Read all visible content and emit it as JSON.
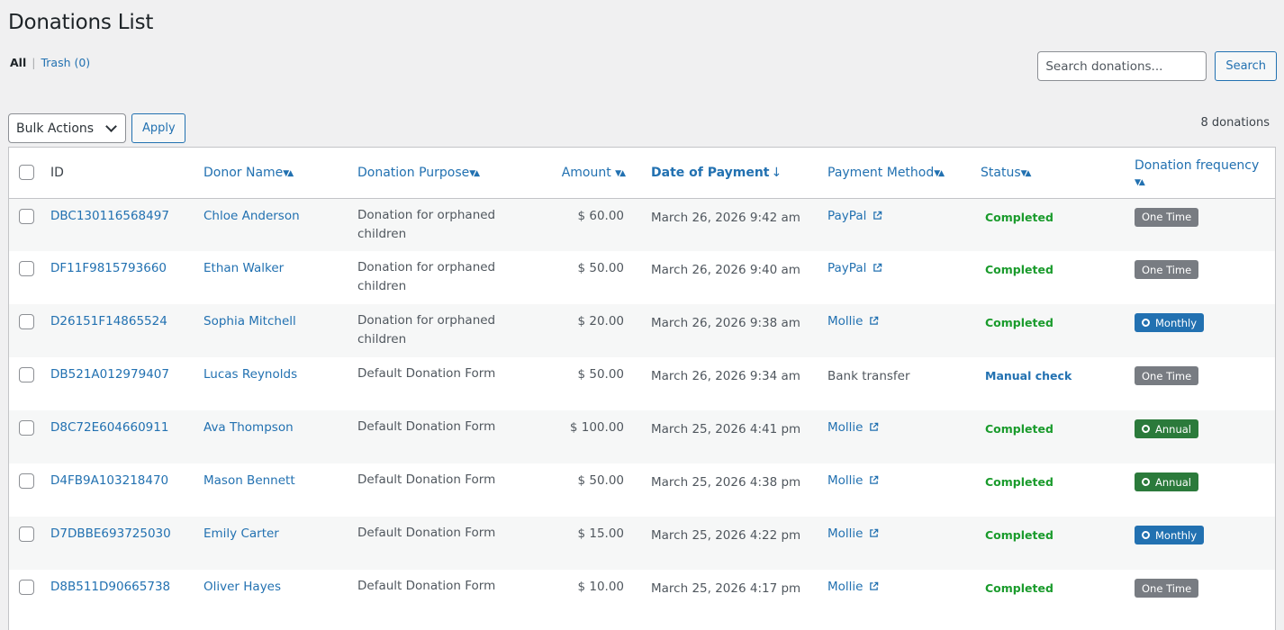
{
  "title": "Donations List",
  "filters": {
    "all": "All",
    "trash": "Trash (0)"
  },
  "search": {
    "placeholder": "Search donations...",
    "button": "Search"
  },
  "bulk": {
    "label": "Bulk Actions",
    "apply": "Apply"
  },
  "count": "8 donations",
  "columns": {
    "id": "ID",
    "donor": "Donor Name",
    "purpose": "Donation Purpose",
    "amount": "Amount",
    "date": "Date of Payment",
    "method": "Payment Method",
    "status": "Status",
    "frequency": "Donation frequency"
  },
  "rows": [
    {
      "id": "DBC130116568497",
      "donor": "Chloe Anderson",
      "purpose": "Donation for orphaned children",
      "amount": "$ 60.00",
      "date": "March 26, 2026 9:42 am",
      "method": "PayPal",
      "method_link": true,
      "status": "Completed",
      "status_type": "completed",
      "frequency": "One Time",
      "freq_type": "onetime"
    },
    {
      "id": "DF11F9815793660",
      "donor": "Ethan Walker",
      "purpose": "Donation for orphaned children",
      "amount": "$ 50.00",
      "date": "March 26, 2026 9:40 am",
      "method": "PayPal",
      "method_link": true,
      "status": "Completed",
      "status_type": "completed",
      "frequency": "One Time",
      "freq_type": "onetime"
    },
    {
      "id": "D26151F14865524",
      "donor": "Sophia Mitchell",
      "purpose": "Donation for orphaned children",
      "amount": "$ 20.00",
      "date": "March 26, 2026 9:38 am",
      "method": "Mollie",
      "method_link": true,
      "status": "Completed",
      "status_type": "completed",
      "frequency": "Monthly",
      "freq_type": "monthly"
    },
    {
      "id": "DB521A012979407",
      "donor": "Lucas Reynolds",
      "purpose": "Default Donation Form",
      "amount": "$ 50.00",
      "date": "March 26, 2026 9:34 am",
      "method": "Bank transfer",
      "method_link": false,
      "status": "Manual check",
      "status_type": "manual",
      "frequency": "One Time",
      "freq_type": "onetime"
    },
    {
      "id": "D8C72E604660911",
      "donor": "Ava Thompson",
      "purpose": "Default Donation Form",
      "amount": "$ 100.00",
      "date": "March 25, 2026 4:41 pm",
      "method": "Mollie",
      "method_link": true,
      "status": "Completed",
      "status_type": "completed",
      "frequency": "Annual",
      "freq_type": "annual"
    },
    {
      "id": "D4FB9A103218470",
      "donor": "Mason Bennett",
      "purpose": "Default Donation Form",
      "amount": "$ 50.00",
      "date": "March 25, 2026 4:38 pm",
      "method": "Mollie",
      "method_link": true,
      "status": "Completed",
      "status_type": "completed",
      "frequency": "Annual",
      "freq_type": "annual"
    },
    {
      "id": "D7DBBE693725030",
      "donor": "Emily Carter",
      "purpose": "Default Donation Form",
      "amount": "$ 15.00",
      "date": "March 25, 2026 4:22 pm",
      "method": "Mollie",
      "method_link": true,
      "status": "Completed",
      "status_type": "completed",
      "frequency": "Monthly",
      "freq_type": "monthly"
    },
    {
      "id": "D8B511D90665738",
      "donor": "Oliver Hayes",
      "purpose": "Default Donation Form",
      "amount": "$ 10.00",
      "date": "March 25, 2026 4:17 pm",
      "method": "Mollie",
      "method_link": true,
      "status": "Completed",
      "status_type": "completed",
      "frequency": "One Time",
      "freq_type": "onetime"
    }
  ]
}
